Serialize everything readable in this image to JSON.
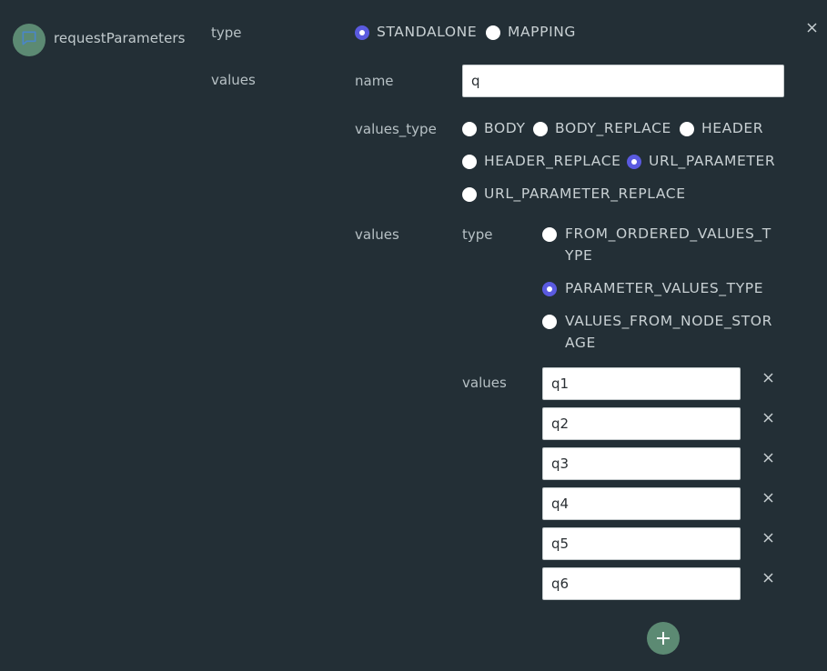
{
  "node": {
    "title": "requestParameters",
    "icon": "message-square-icon"
  },
  "labels": {
    "type": "type",
    "values": "values",
    "name": "name",
    "values_type": "values_type",
    "inner_values": "values",
    "inner_type": "type",
    "list_values": "values"
  },
  "type_options": [
    {
      "label": "STANDALONE",
      "selected": true
    },
    {
      "label": "MAPPING",
      "selected": false
    }
  ],
  "name_value": "q",
  "values_type_options": [
    {
      "label": "BODY",
      "selected": false
    },
    {
      "label": "BODY_REPLACE",
      "selected": false
    },
    {
      "label": "HEADER",
      "selected": false
    },
    {
      "label": "HEADER_REPLACE",
      "selected": false
    },
    {
      "label": "URL_PARAMETER",
      "selected": true
    },
    {
      "label": "URL_PARAMETER_REPLACE",
      "selected": false
    }
  ],
  "values_kind_options": [
    {
      "label_line1": "FROM_ORDERED_VALUES_T",
      "label_line2": "YPE",
      "selected": false
    },
    {
      "label_line1": "PARAMETER_VALUES_TYPE",
      "label_line2": "",
      "selected": true
    },
    {
      "label_line1": "VALUES_FROM_NODE_STOR",
      "label_line2": "AGE",
      "selected": false
    }
  ],
  "list_items": [
    "q1",
    "q2",
    "q3",
    "q4",
    "q5",
    "q6"
  ],
  "colors": {
    "background": "#232f36",
    "accent": "#5a5ae0",
    "badge": "#5c8a73"
  }
}
